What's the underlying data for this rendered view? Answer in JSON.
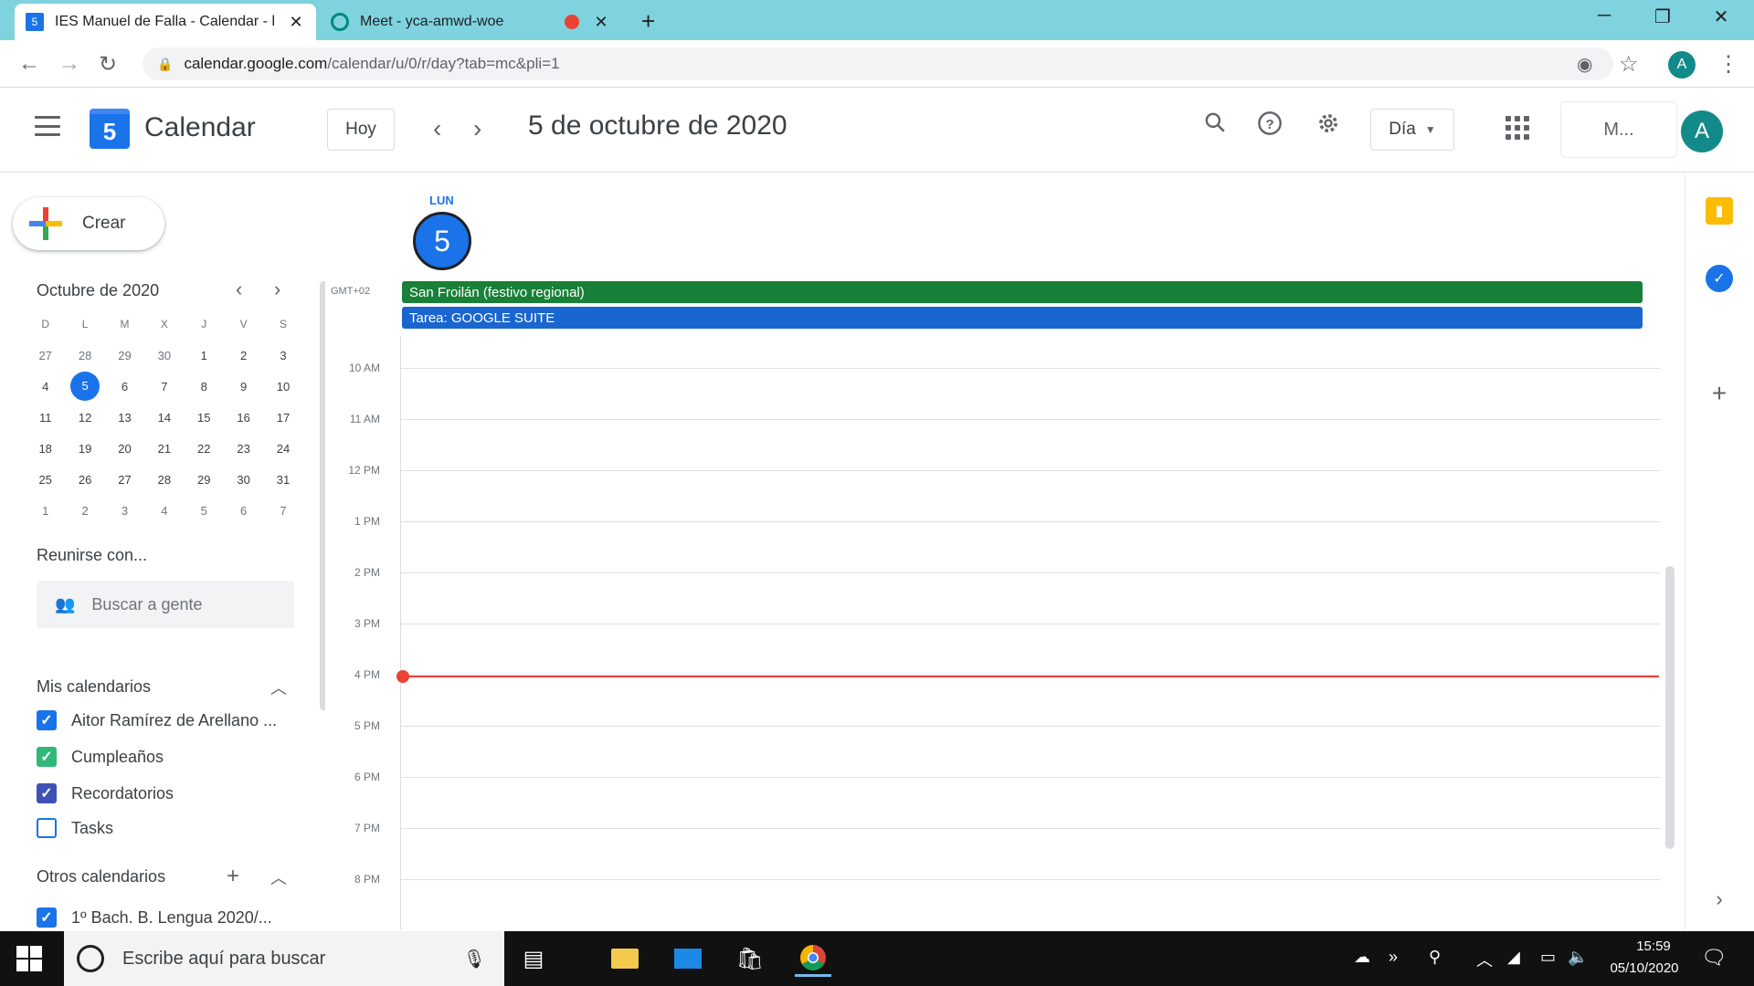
{
  "browser": {
    "tabs": [
      {
        "favicon": "calendar-favicon-icon",
        "title": "IES Manuel de Falla - Calendar - l",
        "close": "✕"
      },
      {
        "favicon": "meet-favicon-icon",
        "title": "Meet - yca-amwd-woe",
        "close": "✕"
      }
    ],
    "new_tab": "+",
    "url_host": "calendar.google.com",
    "url_path": "/calendar/u/0/r/day?tab=mc&pli=1"
  },
  "header": {
    "logo_day": "5",
    "app_title": "Calendar",
    "today_label": "Hoy",
    "date_title": "5 de octubre de 2020",
    "view_label": "Día",
    "org_logo_text": "M...",
    "avatar_letter": "A"
  },
  "sidebar": {
    "create_label": "Crear",
    "mini_title": "Octubre de 2020",
    "weekday_heads": [
      "D",
      "L",
      "M",
      "X",
      "J",
      "V",
      "S"
    ],
    "weeks": [
      [
        "27",
        "28",
        "29",
        "30",
        "1",
        "2",
        "3"
      ],
      [
        "4",
        "5",
        "6",
        "7",
        "8",
        "9",
        "10"
      ],
      [
        "11",
        "12",
        "13",
        "14",
        "15",
        "16",
        "17"
      ],
      [
        "18",
        "19",
        "20",
        "21",
        "22",
        "23",
        "24"
      ],
      [
        "25",
        "26",
        "27",
        "28",
        "29",
        "30",
        "31"
      ],
      [
        "1",
        "2",
        "3",
        "4",
        "5",
        "6",
        "7"
      ]
    ],
    "meet_title": "Reunirse con...",
    "people_placeholder": "Buscar a gente",
    "my_calendars_title": "Mis calendarios",
    "my_calendars": [
      {
        "label": "Aitor Ramírez de Arellano ...",
        "checked": true,
        "color": "#1a73e8"
      },
      {
        "label": "Cumpleaños",
        "checked": true,
        "color": "#33b679"
      },
      {
        "label": "Recordatorios",
        "checked": true,
        "color": "#3f51b5"
      },
      {
        "label": "Tasks",
        "checked": false,
        "color": "#1a73e8"
      }
    ],
    "other_calendars_title": "Otros calendarios",
    "other_calendars": [
      {
        "label": "1º Bach. B. Lengua 2020/...",
        "checked": true,
        "color": "#1a73e8"
      }
    ]
  },
  "day": {
    "weekday": "LUN",
    "number": "5",
    "timezone": "GMT+02",
    "all_day_events": [
      {
        "title": "San Froilán (festivo regional)",
        "color": "#188038"
      },
      {
        "title": "Tarea: GOOGLE SUITE",
        "color": "#1a66d0"
      }
    ],
    "hours": [
      "10 AM",
      "11 AM",
      "12 PM",
      "1 PM",
      "2 PM",
      "3 PM",
      "4 PM",
      "5 PM",
      "6 PM",
      "7 PM",
      "8 PM"
    ],
    "current_time_label": "4 PM"
  },
  "taskbar": {
    "search_placeholder": "Escribe aquí para buscar",
    "time": "15:59",
    "date": "05/10/2020"
  }
}
